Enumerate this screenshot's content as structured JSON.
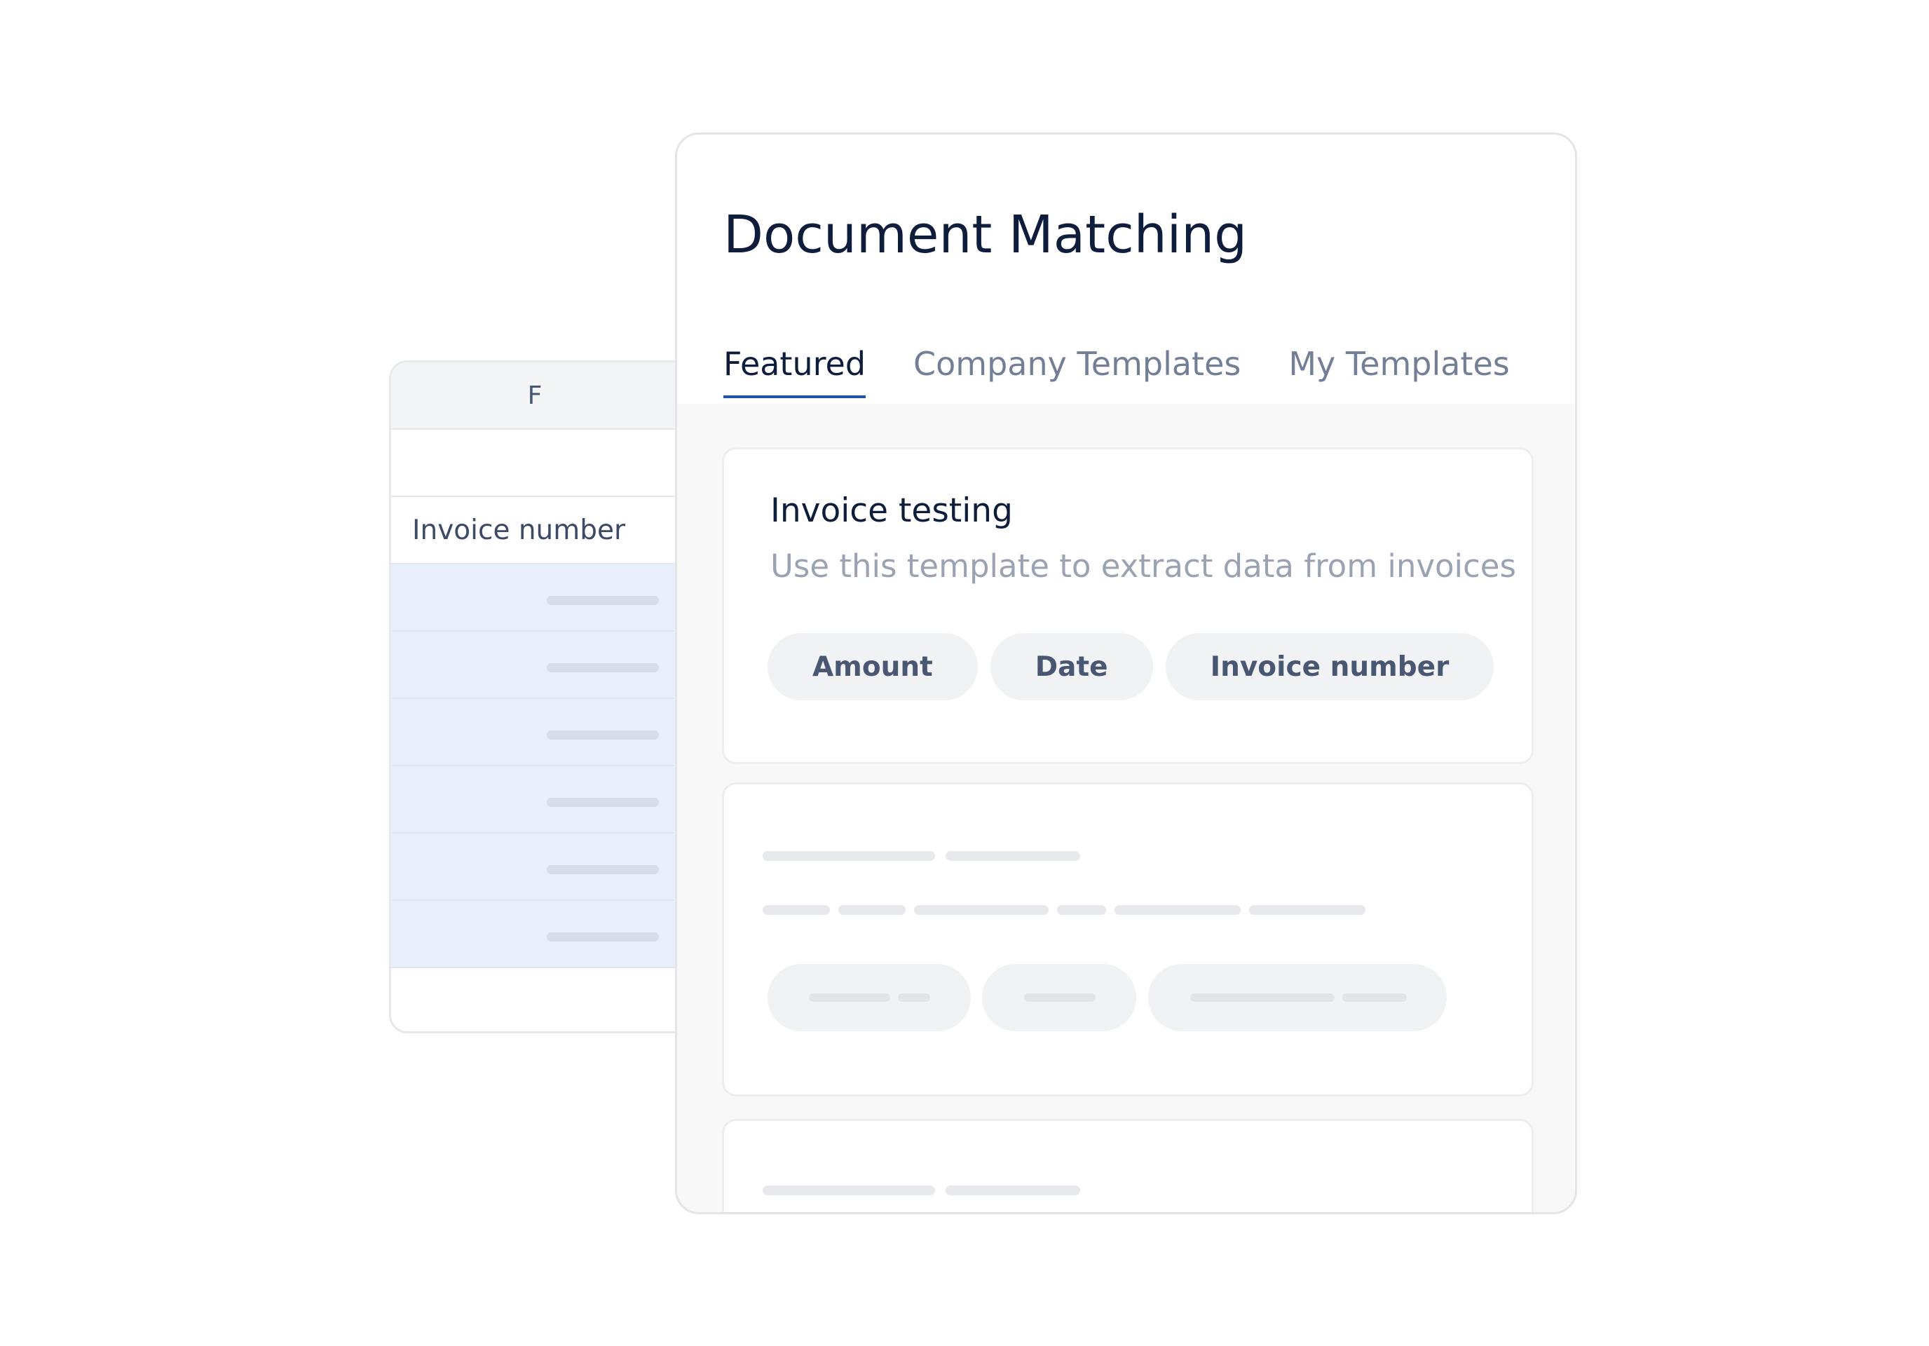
{
  "spreadsheet": {
    "column_letter": "F",
    "label": "Invoice number",
    "data_rows": [
      "",
      "",
      "",
      "",
      "",
      ""
    ]
  },
  "document_matching": {
    "title": "Document Matching",
    "tabs": [
      {
        "label": "Featured",
        "active": true
      },
      {
        "label": "Company Templates",
        "active": false
      },
      {
        "label": "My Templates",
        "active": false
      }
    ],
    "templates": [
      {
        "title": "Invoice testing",
        "description": "Use this template to extract data from invoices",
        "fields": [
          "Amount",
          "Date",
          "Invoice number"
        ]
      }
    ]
  },
  "colors": {
    "title_text": "#0f1d3d",
    "active_tab_underline": "#1f54a6",
    "inactive_tab_text": "#737f96",
    "highlight_rows": "#e8effb",
    "chip_background": "#f1f2f4"
  }
}
